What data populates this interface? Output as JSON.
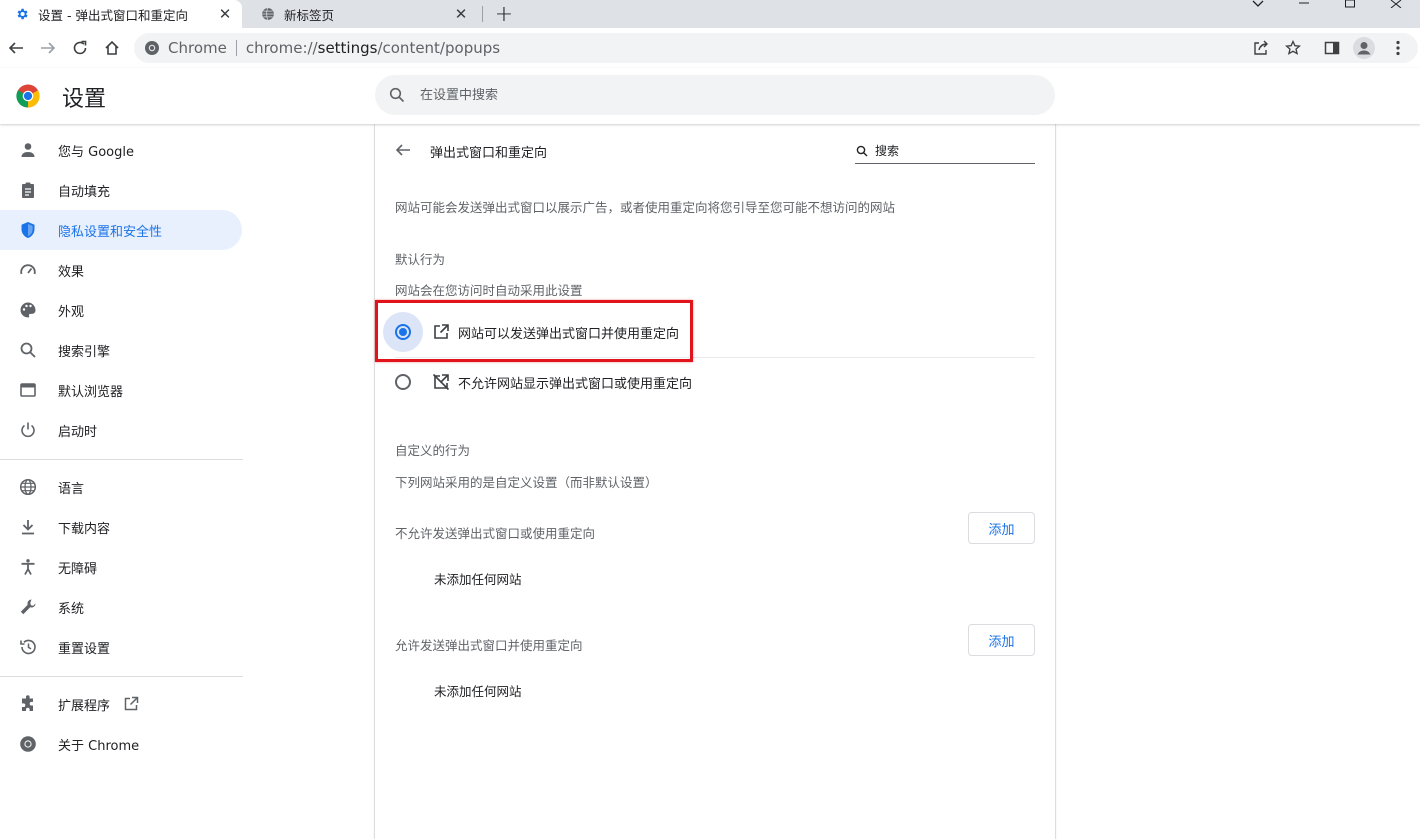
{
  "browser": {
    "tabs": [
      {
        "title": "设置 - 弹出式窗口和重定向",
        "active": true
      },
      {
        "title": "新标签页",
        "active": false
      }
    ],
    "omnibox": {
      "chip": "Chrome",
      "url_prefix": "chrome://",
      "url_host": "settings",
      "url_path": "/content/popups"
    }
  },
  "header": {
    "title": "设置",
    "search_placeholder": "在设置中搜索"
  },
  "sidebar": {
    "items": [
      {
        "label": "您与 Google",
        "icon": "person-icon"
      },
      {
        "label": "自动填充",
        "icon": "clipboard-icon"
      },
      {
        "label": "隐私设置和安全性",
        "icon": "shield-icon",
        "selected": true
      },
      {
        "label": "效果",
        "icon": "speedometer-icon"
      },
      {
        "label": "外观",
        "icon": "palette-icon"
      },
      {
        "label": "搜索引擎",
        "icon": "search-icon"
      },
      {
        "label": "默认浏览器",
        "icon": "browser-window-icon"
      },
      {
        "label": "启动时",
        "icon": "power-icon"
      },
      {
        "label": "语言",
        "icon": "globe-icon"
      },
      {
        "label": "下载内容",
        "icon": "download-icon"
      },
      {
        "label": "无障碍",
        "icon": "accessibility-icon"
      },
      {
        "label": "系统",
        "icon": "wrench-icon"
      },
      {
        "label": "重置设置",
        "icon": "history-icon"
      },
      {
        "label": "扩展程序",
        "icon": "puzzle-icon"
      },
      {
        "label": "关于 Chrome",
        "icon": "chrome-icon"
      }
    ]
  },
  "content": {
    "title": "弹出式窗口和重定向",
    "search_placeholder": "搜索",
    "description": "网站可能会发送弹出式窗口以展示广告，或者使用重定向将您引导至您可能不想访问的网站",
    "default_heading": "默认行为",
    "default_sub": "网站会在您访问时自动采用此设置",
    "options": [
      {
        "label": "网站可以发送弹出式窗口并使用重定向",
        "checked": true,
        "icon": "open-in-new-icon"
      },
      {
        "label": "不允许网站显示弹出式窗口或使用重定向",
        "checked": false,
        "icon": "popup-blocked-icon"
      }
    ],
    "custom_heading": "自定义的行为",
    "custom_sub": "下列网站采用的是自定义设置（而非默认设置）",
    "block_section": {
      "label": "不允许发送弹出式窗口或使用重定向",
      "button": "添加",
      "empty": "未添加任何网站"
    },
    "allow_section": {
      "label": "允许发送弹出式窗口并使用重定向",
      "button": "添加",
      "empty": "未添加任何网站"
    }
  },
  "colors": {
    "accent": "#1a73e8",
    "highlight": "#e0141a",
    "selected_bg": "#e8f0fe"
  }
}
